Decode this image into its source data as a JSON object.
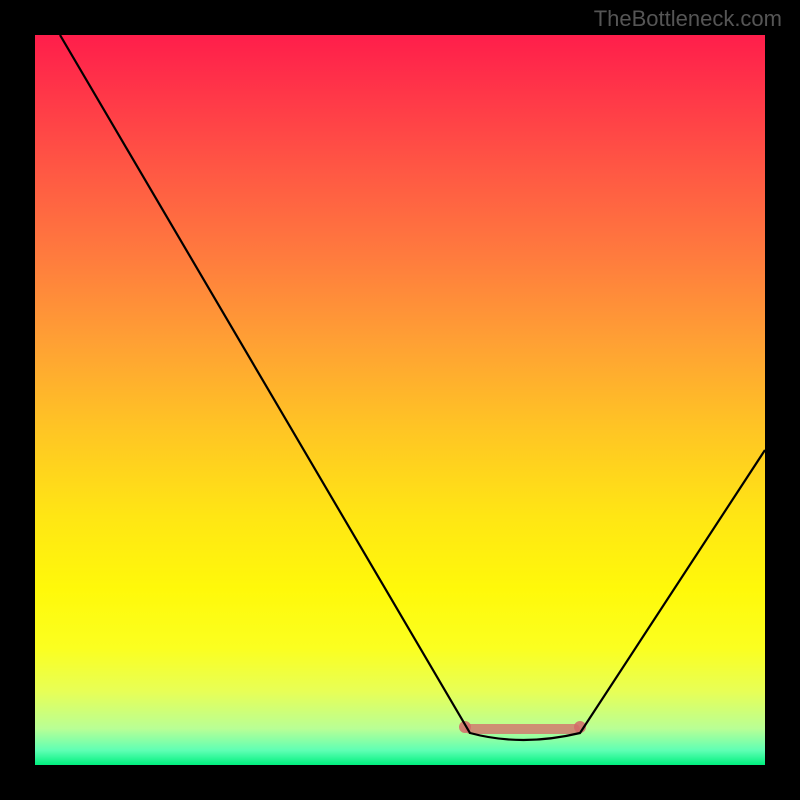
{
  "watermark": "TheBottleneck.com",
  "chart_data": {
    "type": "line",
    "title": "",
    "xlabel": "",
    "ylabel": "",
    "x_range": [
      0,
      100
    ],
    "y_range": [
      0,
      100
    ],
    "description": "V-shaped bottleneck curve plotted over a vertical gradient (red=bad at top, green=good at bottom). Minimum (best) is the flat region around x≈60–74.",
    "gradient_stops": [
      {
        "pos": 0.0,
        "color": "#ff1e4b"
      },
      {
        "pos": 0.18,
        "color": "#ff5644"
      },
      {
        "pos": 0.42,
        "color": "#ffa034"
      },
      {
        "pos": 0.66,
        "color": "#ffe614"
      },
      {
        "pos": 0.9,
        "color": "#e7ff57"
      },
      {
        "pos": 1.0,
        "color": "#00f07e"
      }
    ],
    "series": [
      {
        "name": "bottleneck",
        "x": [
          3,
          10,
          20,
          30,
          40,
          50,
          57,
          60,
          64,
          68,
          72,
          74,
          80,
          90,
          100
        ],
        "y": [
          100,
          88,
          71,
          54,
          37,
          20,
          8,
          4,
          2,
          2,
          3,
          4,
          14,
          30,
          43
        ]
      }
    ],
    "optimal_region": {
      "x_start": 60,
      "x_end": 74,
      "y": 3
    },
    "markers": [
      {
        "name": "optimal-start",
        "x": 59,
        "y": 4
      },
      {
        "name": "optimal-end",
        "x": 75,
        "y": 4
      }
    ]
  }
}
